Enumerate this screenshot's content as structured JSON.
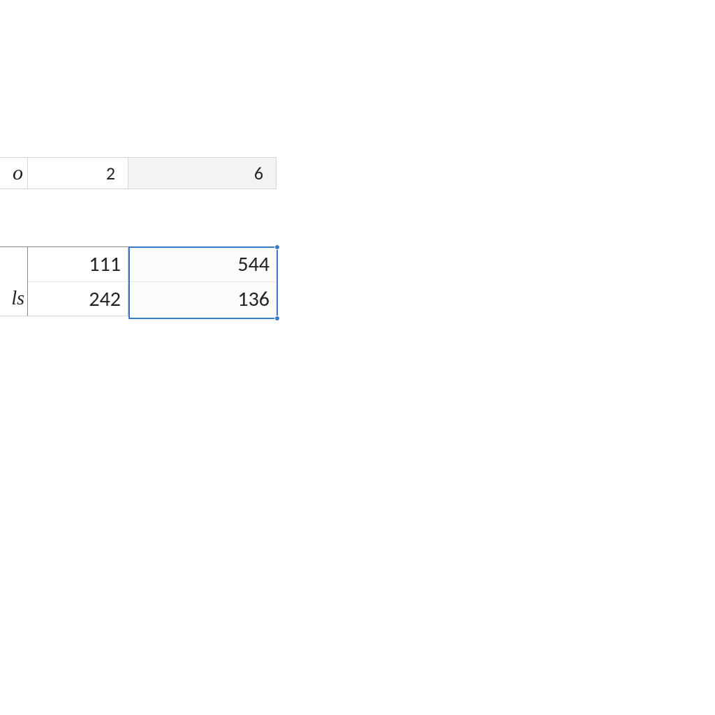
{
  "upper": {
    "label_fragment": "o",
    "cells": [
      "2",
      "6"
    ]
  },
  "lower": {
    "rows": [
      {
        "label_fragment": "",
        "col1": "111",
        "col2": "544"
      },
      {
        "label_fragment": "ls",
        "col1": "242",
        "col2": "136"
      }
    ]
  },
  "selection": {
    "range_description": "lower-table-col2-rows-1-2"
  },
  "colors": {
    "selection_border": "#3a78c9",
    "header_fill": "#f3f3f3",
    "grid_border": "#d8d8d8"
  }
}
